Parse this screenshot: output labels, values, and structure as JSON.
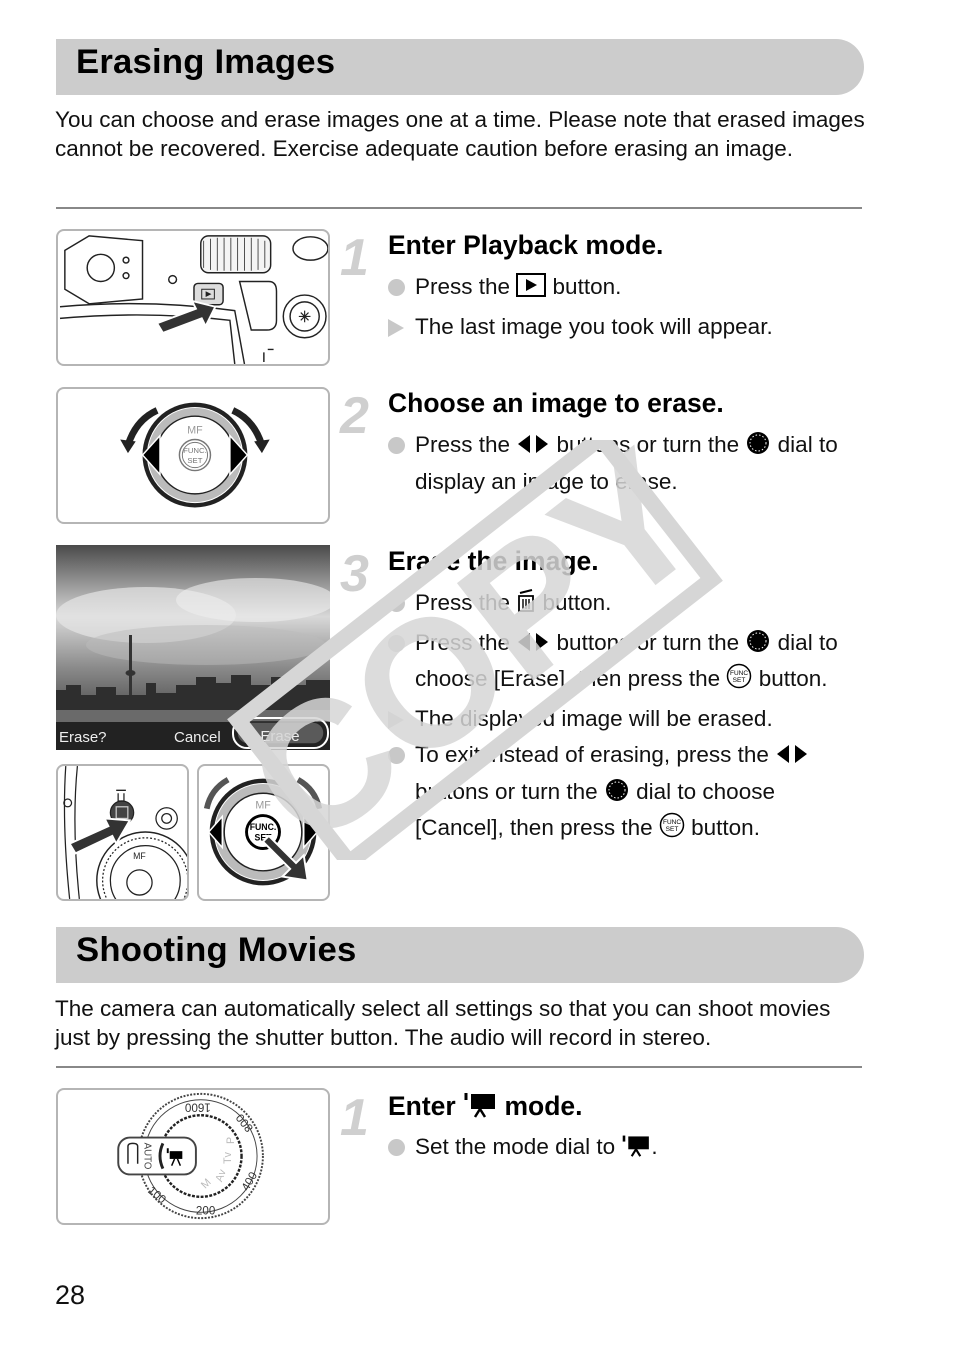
{
  "sections": [
    {
      "title": "Erasing Images",
      "intro": "You can choose and erase images one at a time. Please note that erased images cannot be recovered. Exercise adequate caution before erasing an image.",
      "steps": [
        {
          "number": "1",
          "title": "Enter Playback mode.",
          "items": [
            {
              "type": "action",
              "parts": [
                "Press the ",
                "{playback-icon}",
                " button."
              ]
            },
            {
              "type": "result",
              "parts": [
                "The last image you took will appear."
              ]
            }
          ]
        },
        {
          "number": "2",
          "title": "Choose an image to erase.",
          "items": [
            {
              "type": "action",
              "parts": [
                "Press the ",
                "{left-right-icon}",
                " buttons or turn the ",
                "{control-dial-icon}",
                " dial to display an image to erase."
              ]
            }
          ]
        },
        {
          "number": "3",
          "title": "Erase the image.",
          "items": [
            {
              "type": "action",
              "parts": [
                "Press the ",
                "{trash-icon}",
                " button."
              ]
            },
            {
              "type": "action",
              "parts": [
                "Press the ",
                "{left-right-icon}",
                " buttons or turn the ",
                "{control-dial-icon}",
                " dial to choose [Erase], then press the ",
                "{func-set-icon}",
                " button."
              ]
            },
            {
              "type": "result",
              "parts": [
                "The displayed image will be erased."
              ]
            },
            {
              "type": "action",
              "parts": [
                "To exit instead of erasing, press the ",
                "{left-right-icon}",
                " buttons or turn the ",
                "{control-dial-icon}",
                " dial to choose [Cancel], then press the ",
                "{func-set-icon}",
                " button."
              ]
            }
          ]
        }
      ]
    },
    {
      "title": "Shooting Movies",
      "intro": "The camera can automatically select all settings so that you can shoot movies just by pressing the shutter button. The audio will record in stereo.",
      "steps": [
        {
          "number": "1",
          "title_parts": [
            "Enter ",
            "{movie-icon}",
            " mode."
          ],
          "items": [
            {
              "type": "action",
              "parts": [
                "Set the mode dial to ",
                "{movie-icon}",
                "."
              ]
            }
          ]
        }
      ]
    }
  ],
  "figures": {
    "erase_screen": {
      "prompt": "Erase?",
      "cancel_label": "Cancel",
      "erase_label": "Erase"
    },
    "dial_labels": {
      "mf": "MF",
      "func": "FUNC.",
      "set": "SET"
    },
    "mode_dial_labels": [
      "1600",
      "800",
      "400",
      "200",
      "100",
      "AUTO",
      "P",
      "Tv",
      "Av",
      "M"
    ]
  },
  "watermark": "COPY",
  "page_number": "28",
  "colors": {
    "section_bar": "#cccccc",
    "step_number": "#cfcfcf",
    "bullet_mark": "#c8c8c8",
    "rule": "#888888",
    "watermark": "#d6d6d6"
  }
}
